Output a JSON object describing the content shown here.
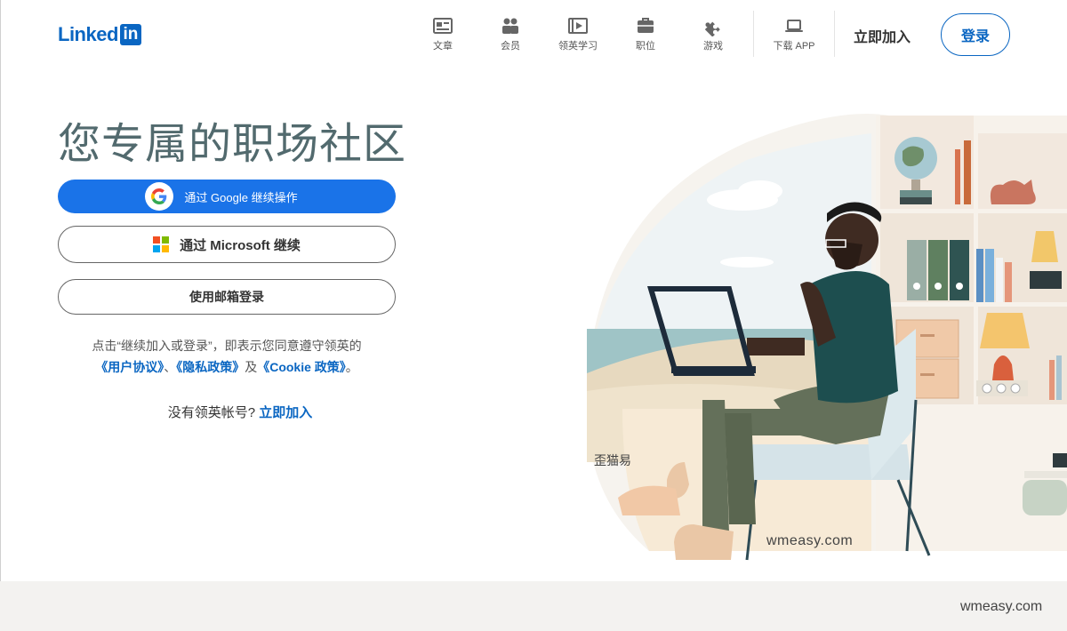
{
  "header": {
    "logo_text": "Linked",
    "logo_box": "in",
    "nav": [
      {
        "label": "文章",
        "icon": "article-icon"
      },
      {
        "label": "会员",
        "icon": "people-icon"
      },
      {
        "label": "领英学习",
        "icon": "learning-icon"
      },
      {
        "label": "职位",
        "icon": "briefcase-icon"
      },
      {
        "label": "游戏",
        "icon": "puzzle-icon"
      },
      {
        "label": "下载 APP",
        "icon": "laptop-icon"
      }
    ],
    "join_label": "立即加入",
    "signin_label": "登录"
  },
  "hero": {
    "title": "您专属的职场社区",
    "google_button": "通过 Google 继续操作",
    "microsoft_button": "通过 Microsoft 继续",
    "email_button": "使用邮箱登录",
    "terms_prefix": "点击“继续加入或登录”，即表示您同意遵守领英的",
    "user_agreement": "《用户协议》",
    "sep1": "、",
    "privacy_policy": "《隐私政策》",
    "sep2": "及",
    "cookie_policy": "《Cookie 政策》",
    "sep3": "。",
    "no_account": "没有领英帐号?",
    "join_now": "立即加入"
  },
  "watermarks": {
    "wm1": "歪猫易",
    "wm2": "wmeasy.com",
    "wm3": "wmeasy.com"
  },
  "colors": {
    "brand": "#0a66c2",
    "google_button": "#1a73e8",
    "title": "#526a6e",
    "footer": "#f3f2f0"
  }
}
